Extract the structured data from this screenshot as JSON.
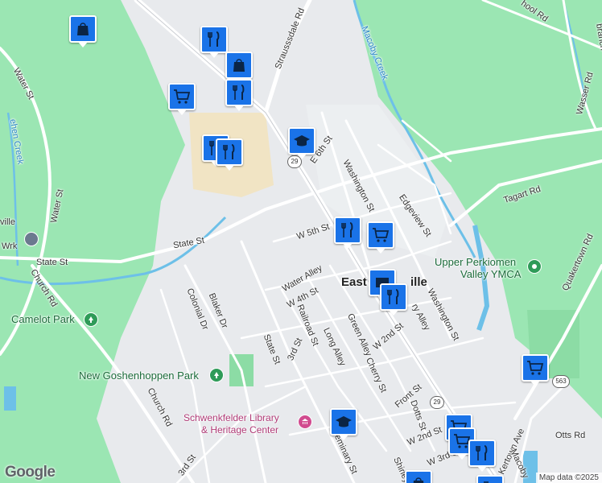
{
  "map": {
    "attribution": "Map data ©2025",
    "logo": "Google",
    "town_label": "East",
    "town_label_suffix": "ille",
    "colors": {
      "land": "#9be6b3",
      "urban": "#e8eaed",
      "road": "#ffffff",
      "water": "#6dc0e8",
      "campus": "#f1e4c4",
      "poi": "#1a73e8"
    },
    "streets": [
      "Water St",
      "Water St",
      "State St",
      "State St",
      "Church Rd",
      "Church Rd",
      "Colonial Dr",
      "Blaker Dr",
      "State St",
      "Railroad St",
      "3rd St",
      "3rd St",
      "Long Alley",
      "Green Alley",
      "W 2nd St",
      "Cherry St",
      "Front St",
      "Dotts St",
      "Seminary St",
      "W 2nd St",
      "W 3rd St",
      "Shirley",
      "Washington St",
      "Washington St",
      "Edgeview St",
      "Tagart Rd",
      "Quakertown Rd",
      "Wasser Rd",
      "Otts Rd",
      "Kertown Ave",
      "Macoby",
      "E 6th St",
      "W 5th St",
      "Water Alley",
      "W 4th St",
      "Strausssdale Rd",
      "ry Alley",
      "hool Rd",
      "branch"
    ],
    "water_labels": [
      "Macoby Creek",
      "ehen Creek"
    ],
    "places": {
      "ymca_line1": "Upper Perkiomen",
      "ymca_line2": "Valley YMCA",
      "camelot": "Camelot Park",
      "goshenhoppen": "New Goshenhoppen Park",
      "library_line1": "Schwenkfelder Library",
      "library_line2": "& Heritage Center",
      "wwtp_a": "ville",
      "wwtp_b": "Wrk"
    },
    "shields": [
      "29",
      "29",
      "563"
    ],
    "pois": [
      {
        "type": "shopping-bag"
      },
      {
        "type": "restaurant"
      },
      {
        "type": "shopping-bag"
      },
      {
        "type": "restaurant"
      },
      {
        "type": "grocery-cart"
      },
      {
        "type": "restaurant"
      },
      {
        "type": "restaurant"
      },
      {
        "type": "school"
      },
      {
        "type": "restaurant"
      },
      {
        "type": "grocery-cart"
      },
      {
        "type": "shopping-bag"
      },
      {
        "type": "restaurant"
      },
      {
        "type": "grocery-cart"
      },
      {
        "type": "school"
      },
      {
        "type": "grocery-cart"
      },
      {
        "type": "grocery-cart"
      },
      {
        "type": "restaurant"
      },
      {
        "type": "shopping-bag"
      },
      {
        "type": "restaurant"
      }
    ]
  }
}
